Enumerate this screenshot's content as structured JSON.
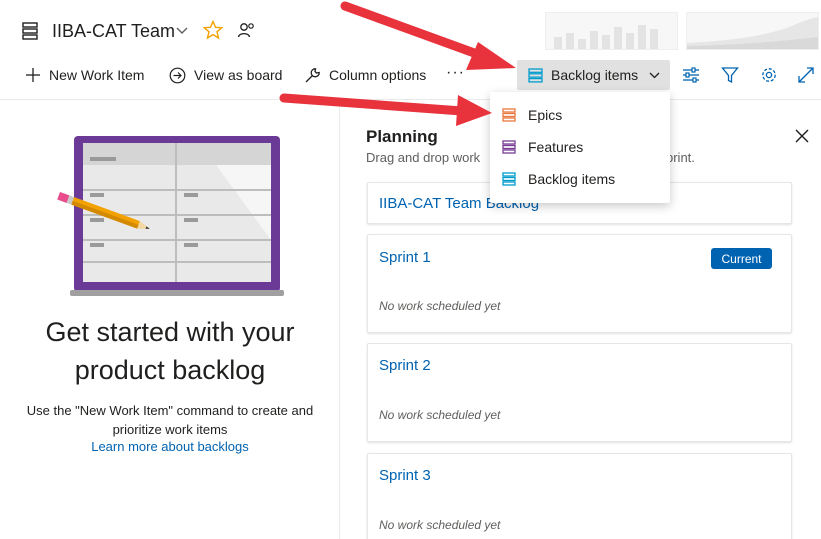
{
  "header": {
    "team_name": "IIBA-CAT Team",
    "icons": [
      "backlog-icon",
      "chevron-down-icon",
      "star-icon",
      "people-settings-icon"
    ]
  },
  "toolbar": {
    "new_work_item": "New Work Item",
    "view_as_board": "View as board",
    "column_options": "Column options",
    "more": "···",
    "backlog_level": "Backlog items",
    "icons": [
      "settings-sliders-icon",
      "filter-icon",
      "gear-icon",
      "expand-icon"
    ]
  },
  "dropdown": {
    "items": [
      {
        "label": "Epics",
        "color": "#e8773d"
      },
      {
        "label": "Features",
        "color": "#773b93"
      },
      {
        "label": "Backlog items",
        "color": "#009ccc"
      }
    ]
  },
  "empty_state": {
    "title": "Get started with your product backlog",
    "description": "Use the \"New Work Item\" command to create and prioritize work items",
    "link": "Learn more about backlogs"
  },
  "planning": {
    "title": "Planning",
    "subtitle": "Drag and drop work",
    "subtitle_tail": "print.",
    "cards": [
      {
        "title": "IIBA-CAT Team Backlog"
      },
      {
        "title": "Sprint 1",
        "badge": "Current",
        "empty_text": "No work scheduled yet"
      },
      {
        "title": "Sprint 2",
        "empty_text": "No work scheduled yet"
      },
      {
        "title": "Sprint 3",
        "empty_text": "No work scheduled yet"
      }
    ]
  },
  "colors": {
    "accent": "#0063b1",
    "arrow": "#e8323c",
    "illustration_frame": "#6b3a96"
  }
}
